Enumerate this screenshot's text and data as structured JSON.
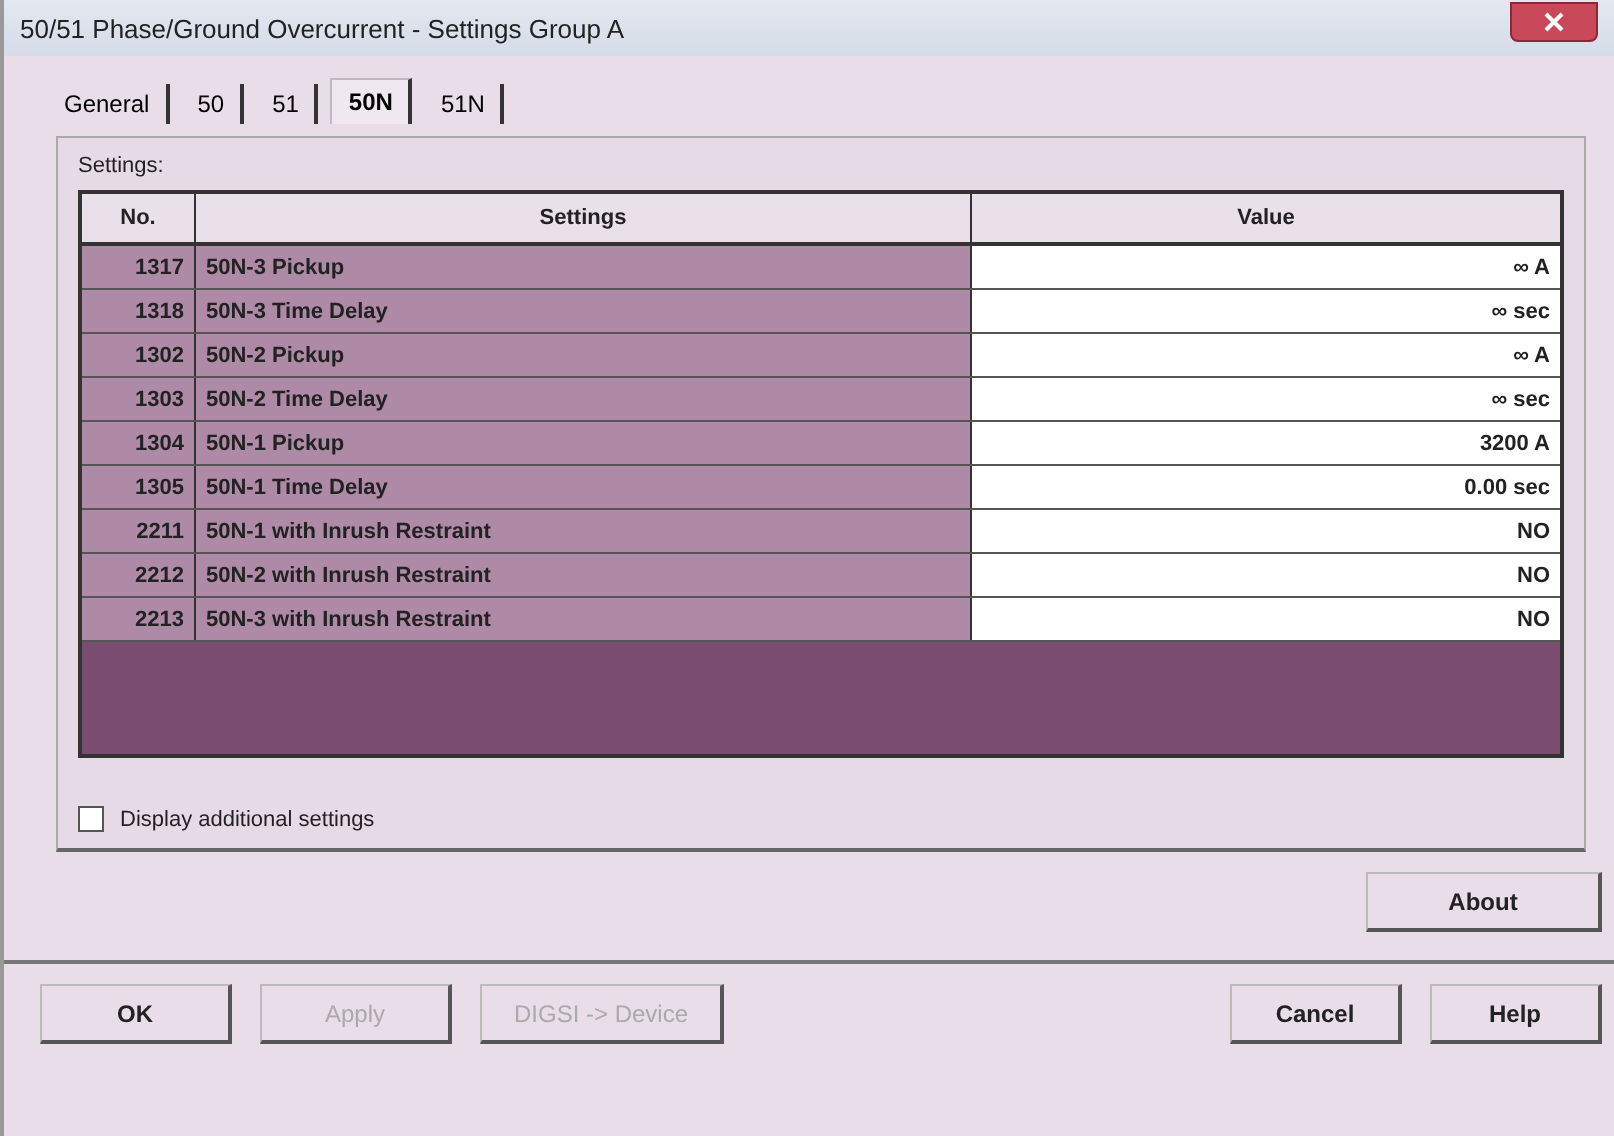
{
  "window": {
    "title": "50/51 Phase/Ground Overcurrent - Settings Group A"
  },
  "tabs": [
    {
      "label": "General",
      "selected": false
    },
    {
      "label": "50",
      "selected": false
    },
    {
      "label": "51",
      "selected": false
    },
    {
      "label": "50N",
      "selected": true
    },
    {
      "label": "51N",
      "selected": false
    }
  ],
  "settings_label": "Settings:",
  "table": {
    "columns": [
      "No.",
      "Settings",
      "Value"
    ],
    "rows": [
      [
        "1317",
        "50N-3 Pickup",
        "∞ A"
      ],
      [
        "1318",
        "50N-3 Time Delay",
        "∞ sec"
      ],
      [
        "1302",
        "50N-2  Pickup",
        "∞ A"
      ],
      [
        "1303",
        "50N-2 Time Delay",
        "∞ sec"
      ],
      [
        "1304",
        "50N-1 Pickup",
        "3200 A"
      ],
      [
        "1305",
        "50N-1 Time Delay",
        "0.00 sec"
      ],
      [
        "2211",
        "50N-1 with Inrush Restraint",
        "NO"
      ],
      [
        "2212",
        "50N-2 with Inrush Restraint",
        "NO"
      ],
      [
        "2213",
        "50N-3 with Inrush Restraint",
        "NO"
      ]
    ]
  },
  "display_additional": {
    "label": "Display additional settings",
    "checked": false
  },
  "about_button": "About",
  "buttons": [
    {
      "label": "OK",
      "disabled": false
    },
    {
      "label": "Apply",
      "disabled": true
    },
    {
      "label": "DIGSI -> Device",
      "disabled": true
    }
  ],
  "right_buttons": [
    {
      "label": "Cancel",
      "disabled": false
    },
    {
      "label": "Help",
      "disabled": false
    }
  ]
}
